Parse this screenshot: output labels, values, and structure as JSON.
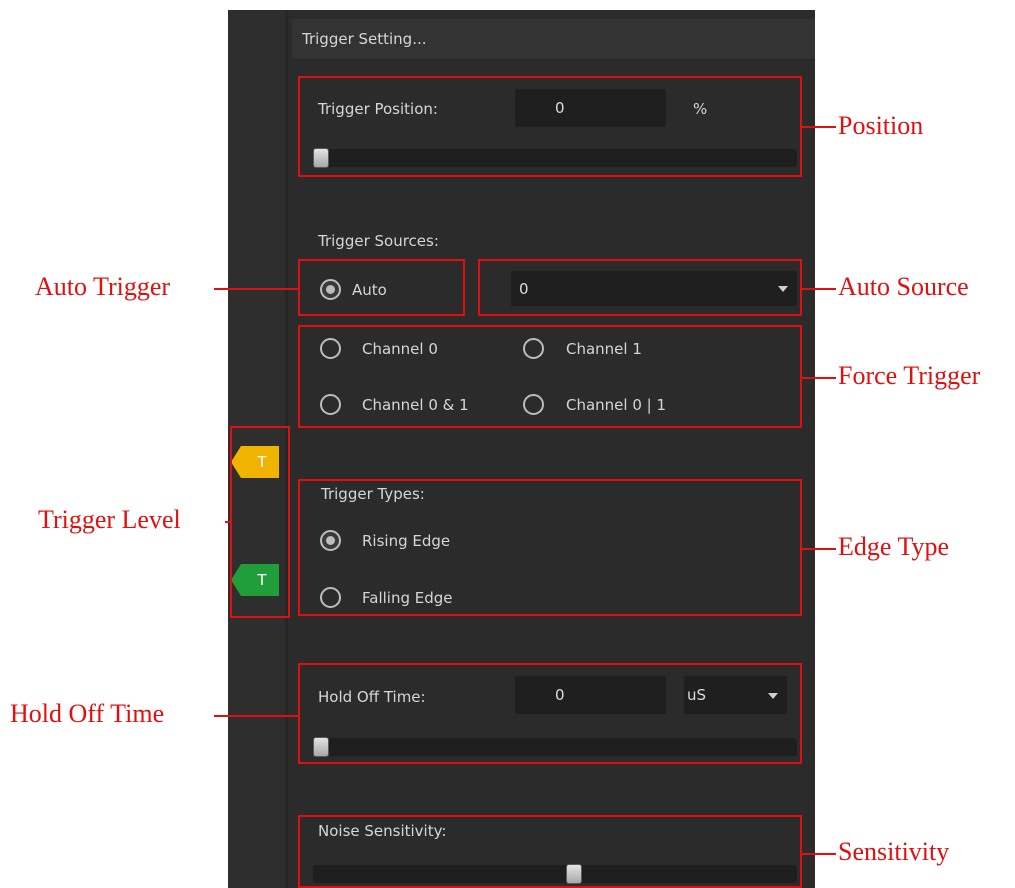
{
  "panel": {
    "title": "Trigger Setting...",
    "position": {
      "label": "Trigger Position:",
      "value": "0",
      "unit": "%",
      "slider_fraction": 0.0
    },
    "sources": {
      "label": "Trigger Sources:",
      "auto": {
        "label": "Auto",
        "checked": true
      },
      "auto_select": {
        "value": "0"
      },
      "channels": [
        {
          "label": "Channel 0",
          "checked": false
        },
        {
          "label": "Channel 1",
          "checked": false
        },
        {
          "label": "Channel 0 & 1",
          "checked": false
        },
        {
          "label": "Channel 0 | 1",
          "checked": false
        }
      ]
    },
    "types": {
      "label": "Trigger Types:",
      "options": [
        {
          "label": "Rising Edge",
          "checked": true
        },
        {
          "label": "Falling Edge",
          "checked": false
        }
      ]
    },
    "holdoff": {
      "label": "Hold Off Time:",
      "value": "0",
      "unit": "uS",
      "slider_fraction": 0.0
    },
    "noise": {
      "label": "Noise Sensitivity:",
      "slider_fraction": 0.54
    }
  },
  "markers": [
    {
      "label": "T",
      "color": "#f0b400"
    },
    {
      "label": "T",
      "color": "#1f9e3a"
    }
  ],
  "annotations": {
    "position": "Position",
    "auto_trigger": "Auto Trigger",
    "auto_source": "Auto Source",
    "force_trigger": "Force Trigger",
    "trigger_level": "Trigger Level",
    "edge_type": "Edge Type",
    "hold_off_time": "Hold Off Time",
    "sensitivity": "Sensitivity"
  },
  "colors": {
    "annotation": "#e01010",
    "panel_bg": "#2b2b2b"
  }
}
